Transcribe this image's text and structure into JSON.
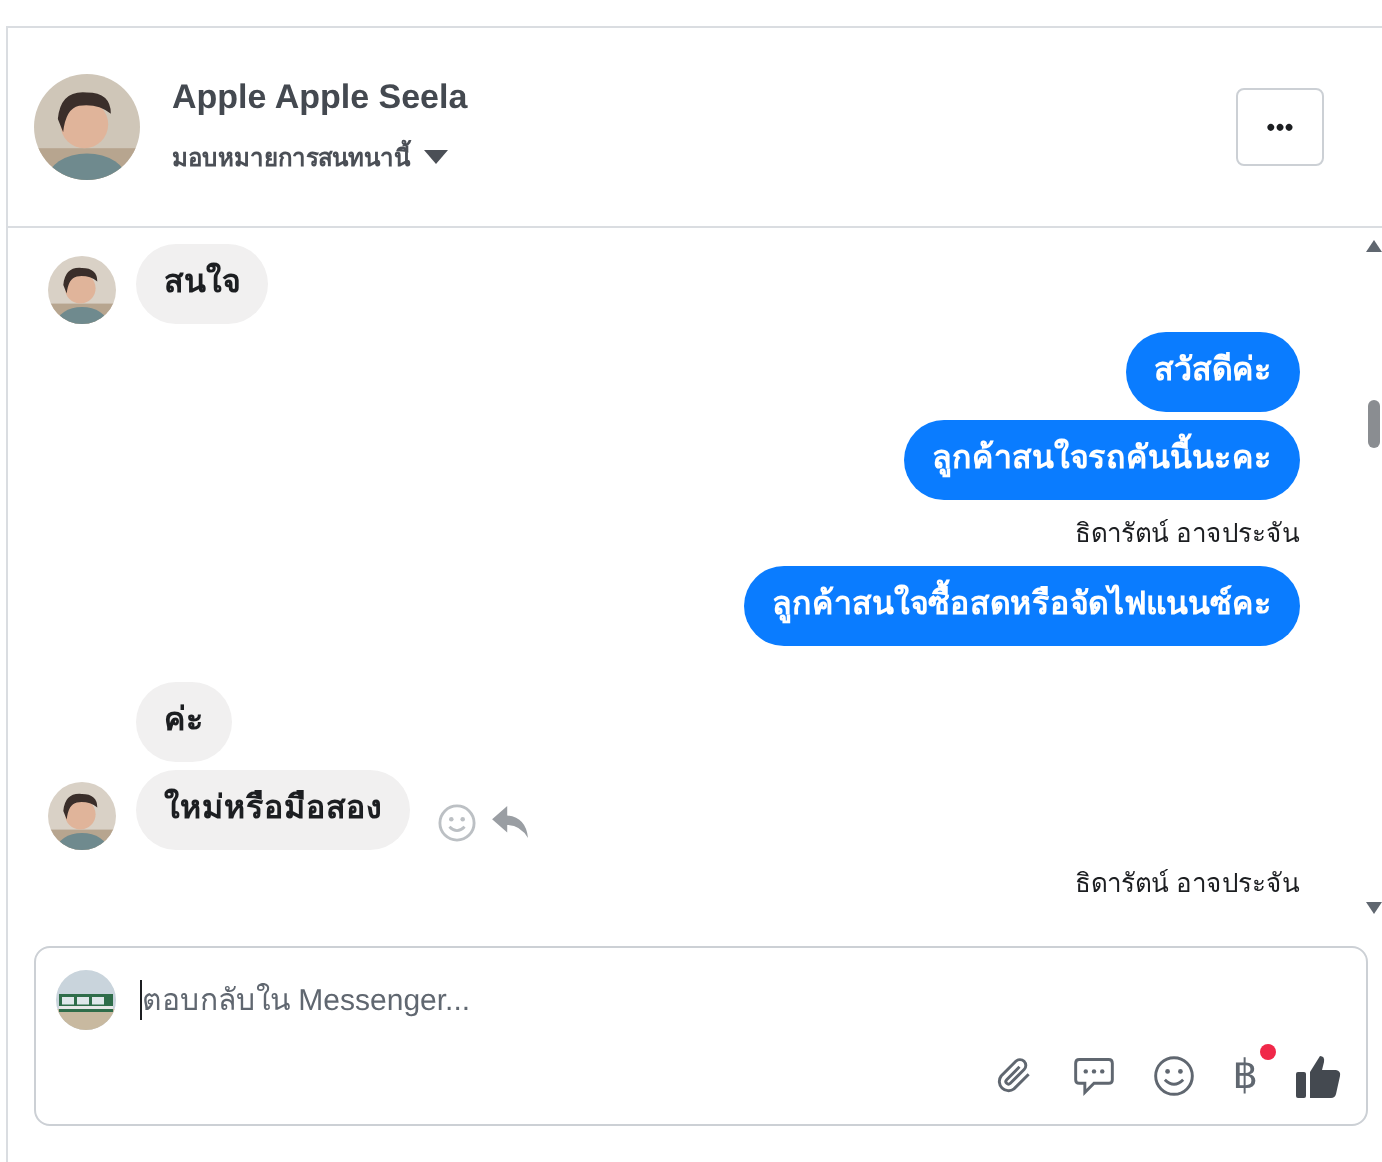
{
  "header": {
    "name": "Apple Apple Seela",
    "subtitle": "มอบหมายการสนทนานี้",
    "more_button": "•••"
  },
  "messages": [
    {
      "kind": "received",
      "text": "สนใจ",
      "show_avatar": true,
      "actions": false
    },
    {
      "kind": "sent",
      "text": "สวัสดีค่ะ"
    },
    {
      "kind": "sent",
      "text": "ลูกค้าสนใจรถคันนี้นะคะ"
    },
    {
      "kind": "sender_label",
      "text": "ธิดารัตน์ อาจประจัน"
    },
    {
      "kind": "sent",
      "text": "ลูกค้าสนใจซื้อสดหรือจัดไฟแนนซ์คะ"
    },
    {
      "kind": "received",
      "text": "ค่ะ",
      "show_avatar": false,
      "actions": false
    },
    {
      "kind": "received",
      "text": "ใหม่หรือมือสอง",
      "show_avatar": true,
      "actions": true
    },
    {
      "kind": "sender_label",
      "text": "ธิดารัตน์ อาจประจัน"
    }
  ],
  "composer": {
    "placeholder": "ตอบกลับใน Messenger...",
    "currency_symbol": "฿",
    "currency_badge": true
  }
}
